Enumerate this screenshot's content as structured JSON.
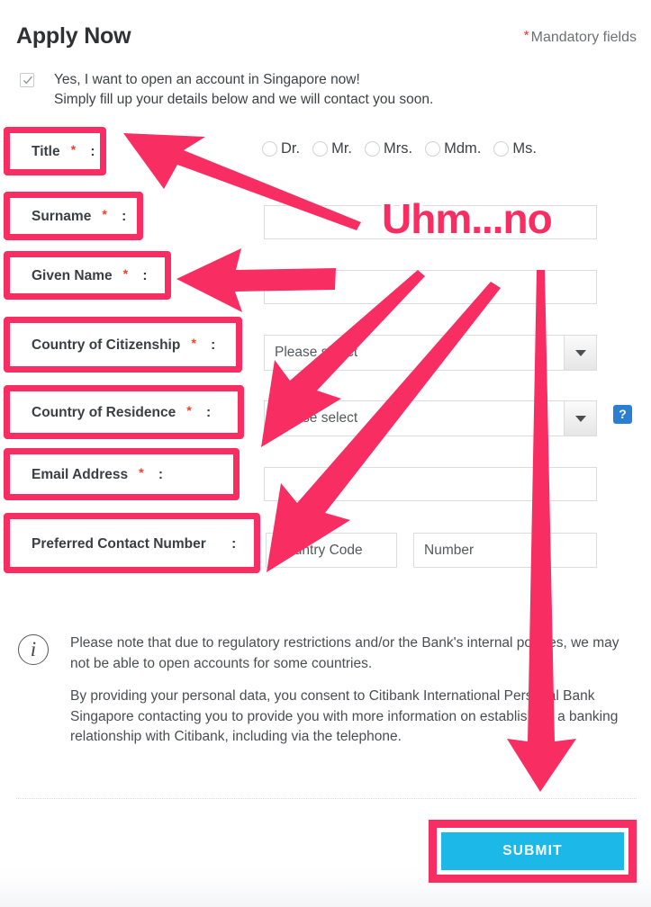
{
  "header": {
    "title": "Apply Now",
    "mandatory_note": "Mandatory fields",
    "mandatory_star": "*"
  },
  "consent": {
    "checked": true,
    "line1": "Yes, I want to open an account in Singapore now!",
    "line2": "Simply fill up your details below and we will contact you soon."
  },
  "annotation": {
    "sticker_text": "Uhm...no",
    "color": "#f82e62"
  },
  "labels": [
    {
      "name": "title",
      "text": "Title",
      "star": "*",
      "suffix": " :"
    },
    {
      "name": "surname",
      "text": "Surname",
      "star": "*",
      "suffix": " :"
    },
    {
      "name": "given-name",
      "text": "Given Name",
      "star": "*",
      "suffix": " :"
    },
    {
      "name": "country-of-citizenship",
      "text": "Country of Citizenship",
      "star": "*",
      "suffix": " :"
    },
    {
      "name": "country-of-residence",
      "text": "Country of Residence",
      "star": "*",
      "suffix": " :"
    },
    {
      "name": "email-address",
      "text": "Email Address",
      "star": "*",
      "suffix": " :"
    },
    {
      "name": "preferred-contact-number",
      "text": "Preferred Contact Number",
      "star": "",
      "suffix": " :"
    }
  ],
  "title_options": [
    {
      "label": "Dr.",
      "selected": false
    },
    {
      "label": "Mr.",
      "selected": false
    },
    {
      "label": "Mrs.",
      "selected": false
    },
    {
      "label": "Mdm.",
      "selected": false
    },
    {
      "label": "Ms.",
      "selected": false
    }
  ],
  "fields": {
    "surname": {
      "value": "",
      "placeholder": ""
    },
    "given_name": {
      "value": "",
      "placeholder": ""
    },
    "country_of_citizenship": {
      "value": "Please select",
      "placeholder": "Please select"
    },
    "country_of_residence": {
      "value": "Please select",
      "placeholder": "Please select"
    },
    "email_address": {
      "value": "",
      "placeholder": ""
    },
    "country_code": {
      "value": "",
      "placeholder": "Country Code"
    },
    "phone_number": {
      "value": "",
      "placeholder": "Number"
    }
  },
  "help": {
    "glyph": "?"
  },
  "legal": {
    "icon_glyph": "i",
    "paragraph1": "Please note that due to regulatory restrictions and/or the Bank's internal policies, we may not be able to open accounts for some countries.",
    "paragraph2": "By providing your personal data, you consent to Citibank International Personal Bank Singapore contacting you to provide you with more information on establishing a banking relationship with Citibank, including via the telephone."
  },
  "submit": {
    "label": "SUBMIT",
    "color": "#1cb9e8"
  }
}
